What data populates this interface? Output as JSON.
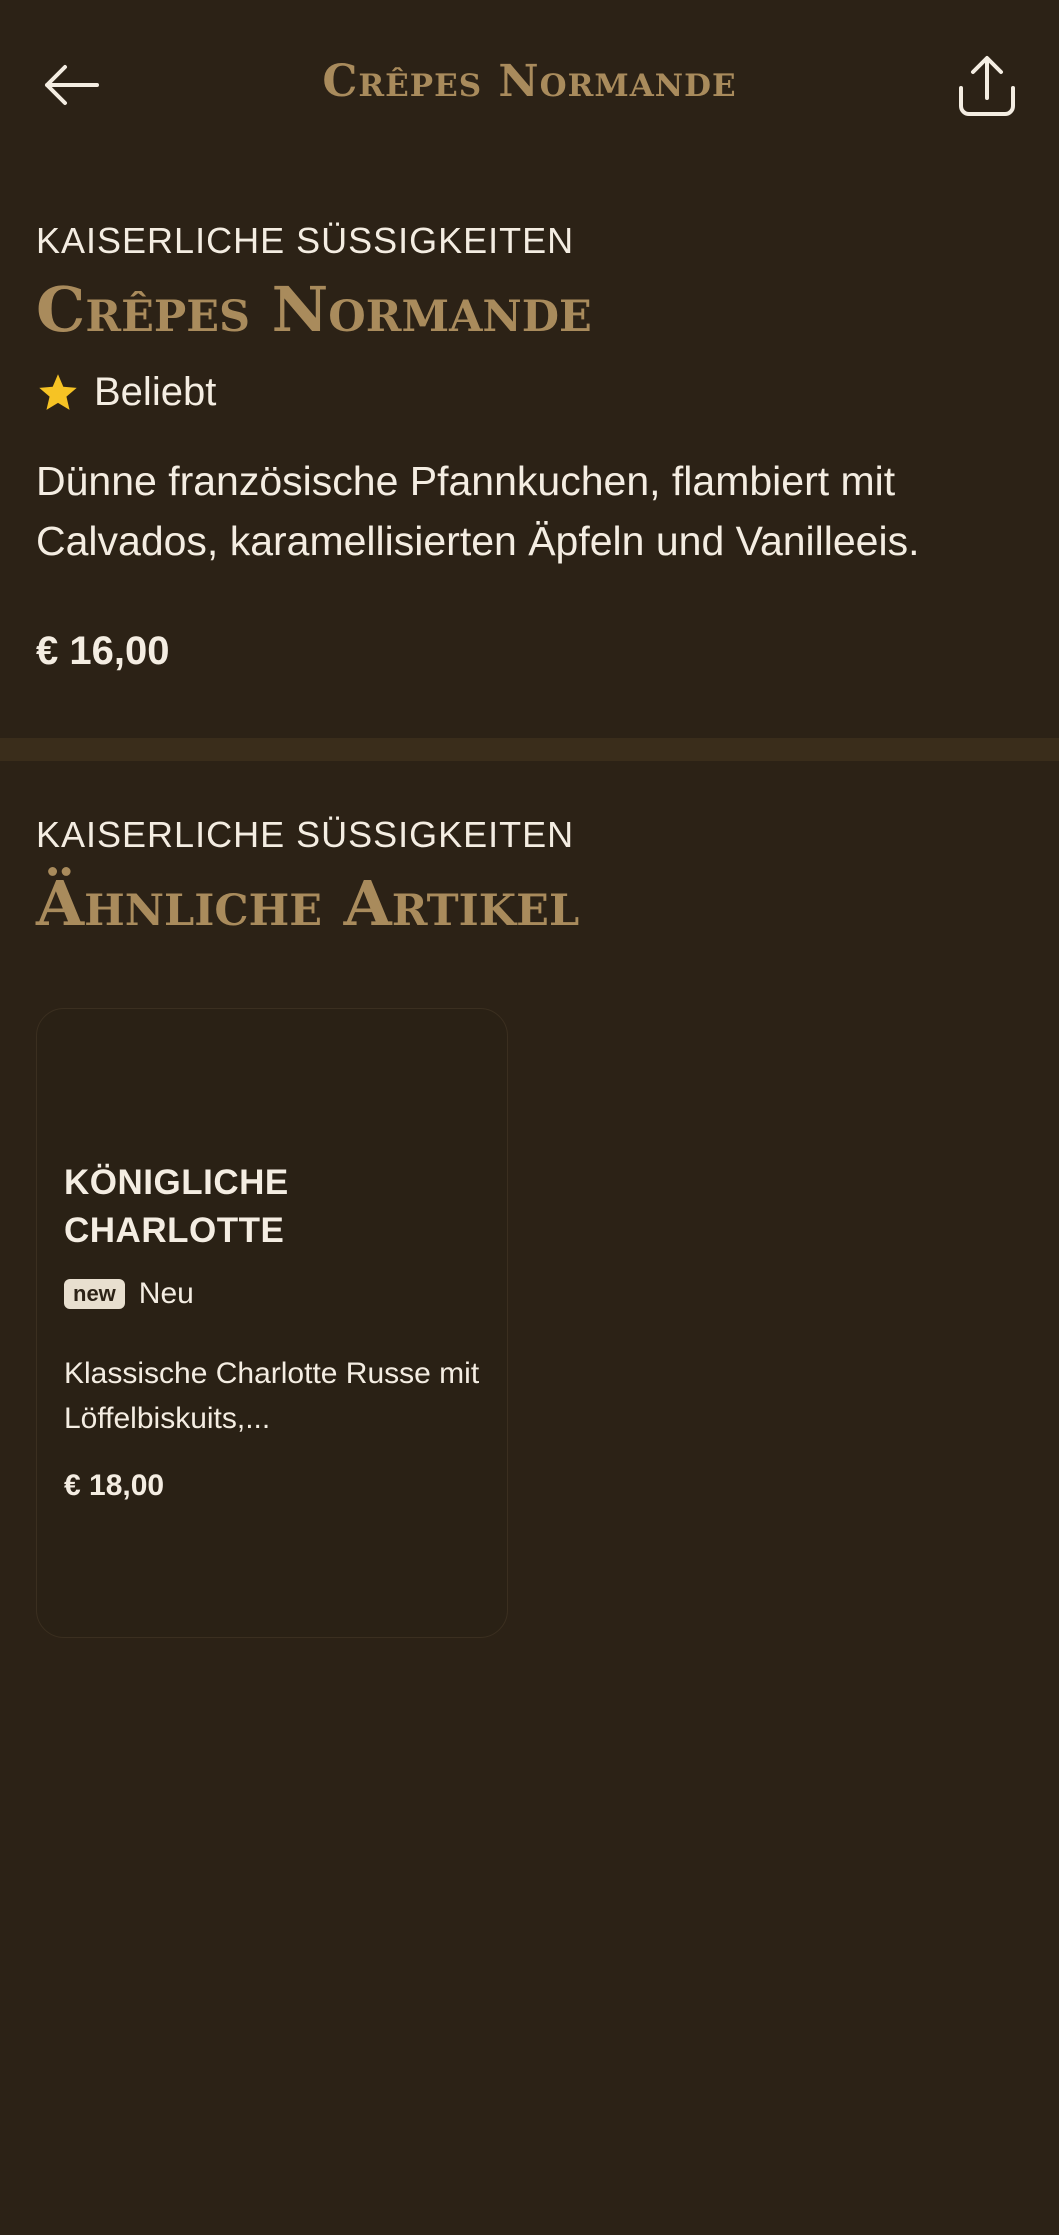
{
  "header": {
    "title": "Crêpes Normande",
    "back_icon": "arrow-left-icon",
    "share_icon": "share-icon"
  },
  "item": {
    "category": "KAISERLICHE SÜSSIGKEITEN",
    "title": "Crêpes Normande",
    "badge_label": "Beliebt",
    "badge_icon": "star-icon",
    "description": "Dünne französische Pfannkuchen, flambiert mit Calvados, karamellisierten Äpfeln und Vanilleeis.",
    "price": "€ 16,00"
  },
  "similar": {
    "category": "KAISERLICHE SÜSSIGKEITEN",
    "heading": "Ähnliche Artikel",
    "items": [
      {
        "title": "KÖNIGLICHE CHARLOTTE",
        "tag": "new",
        "tag_label": "Neu",
        "description": "Klassische Charlotte Russe mit Löffelbiskuits,...",
        "price": "€ 18,00"
      }
    ]
  },
  "colors": {
    "background": "#2c2216",
    "accent_gold": "#a98b5c",
    "text": "#f4ede2",
    "star": "#f6c324"
  }
}
